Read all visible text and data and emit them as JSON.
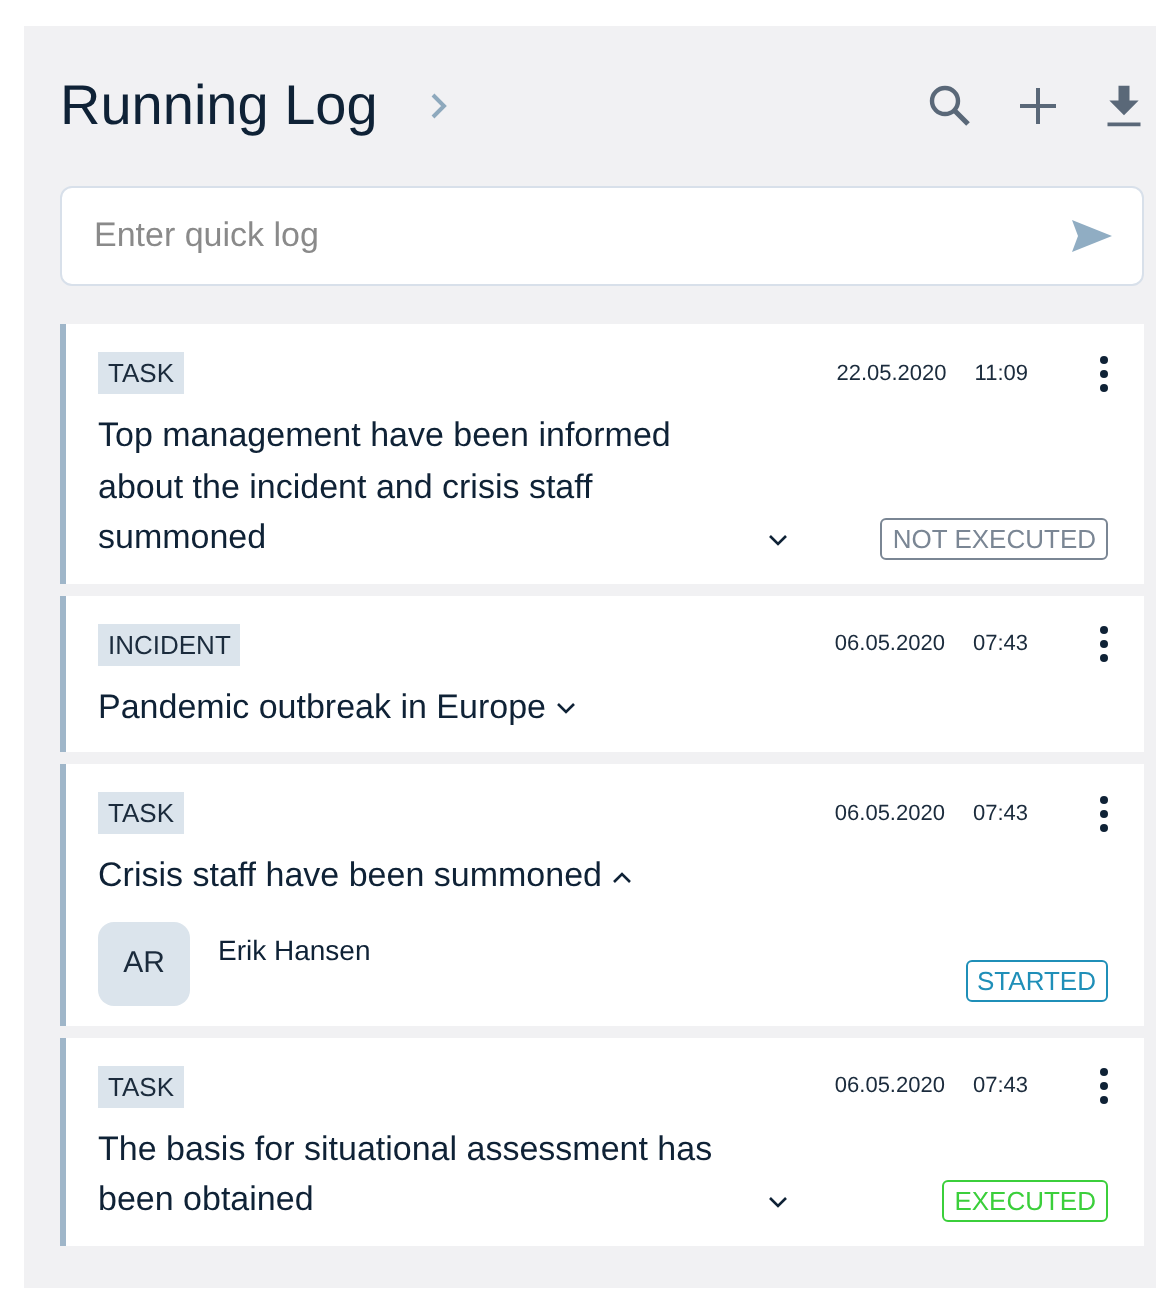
{
  "header": {
    "title": "Running Log"
  },
  "quick_log": {
    "placeholder": "Enter quick log"
  },
  "entries": [
    {
      "type": "TASK",
      "date": "22.05.2020",
      "time": "11:09",
      "text": "Top management have been informed about the incident and crisis staff summoned",
      "expanded": false,
      "status": {
        "label": "NOT EXECUTED",
        "color": "#7a8694"
      }
    },
    {
      "type": "INCIDENT",
      "date": "06.05.2020",
      "time": "07:43",
      "text": "Pandemic outbreak in Europe",
      "expanded": false
    },
    {
      "type": "TASK",
      "date": "06.05.2020",
      "time": "07:43",
      "text": "Crisis staff have been summoned",
      "expanded": true,
      "assignee": {
        "initials": "AR",
        "name": "Erik Hansen"
      },
      "status": {
        "label": "STARTED",
        "color": "#1f8fb8"
      }
    },
    {
      "type": "TASK",
      "date": "06.05.2020",
      "time": "07:43",
      "text": "The basis for situational assessment has been obtained",
      "expanded": false,
      "status": {
        "label": "EXECUTED",
        "color": "#3bcf3b"
      }
    }
  ]
}
